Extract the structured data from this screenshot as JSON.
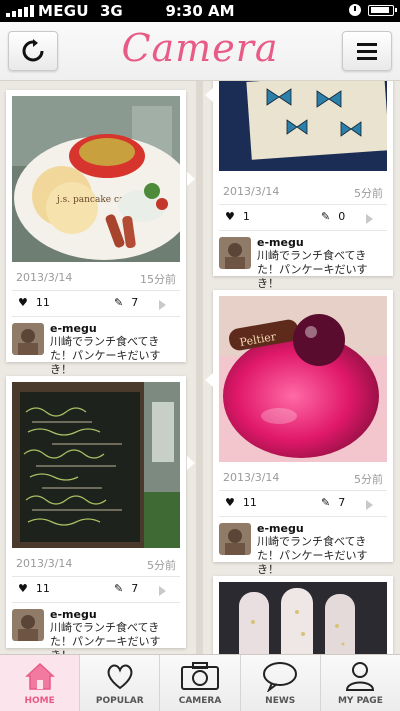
{
  "status_bar": {
    "carrier": "MEGU",
    "network": "3G",
    "time": "9:30 AM"
  },
  "header": {
    "title": "Camera",
    "refresh_icon": "refresh-icon",
    "menu_icon": "hamburger-menu-icon"
  },
  "theme": {
    "accent": "#e85b86",
    "background": "#ece8e2"
  },
  "cards": [
    {
      "date": "2013/3/14",
      "ago": "15分前",
      "likes": "11",
      "comments": "7",
      "user": "e-megu",
      "message": "川崎でランチ食べてきた！パンケーキだいすき！",
      "photo_text": "j.s. pancake cafe"
    },
    {
      "date": "2013/3/14",
      "ago": "5分前",
      "likes": "11",
      "comments": "7",
      "user": "e-megu",
      "message": "川崎でランチ食べてきた！パンケーキだいすき！",
      "photo_text": ""
    },
    {
      "date": "2013/3/14",
      "ago": "5分前",
      "likes": "1",
      "comments": "0",
      "user": "e-megu",
      "message": "川崎でランチ食べてきた！パンケーキだいすき！",
      "photo_text": ""
    },
    {
      "date": "2013/3/14",
      "ago": "5分前",
      "likes": "11",
      "comments": "7",
      "user": "e-megu",
      "message": "川崎でランチ食べてきた！パンケーキだいすき！",
      "photo_text": "Peltier"
    }
  ],
  "tabs": [
    {
      "label": "HOME",
      "icon": "home-icon",
      "active": true
    },
    {
      "label": "POPULAR",
      "icon": "heart-icon",
      "active": false
    },
    {
      "label": "CAMERA",
      "icon": "camera-icon",
      "active": false
    },
    {
      "label": "NEWS",
      "icon": "speech-bubble-icon",
      "active": false
    },
    {
      "label": "MY PAGE",
      "icon": "user-icon",
      "active": false
    }
  ]
}
